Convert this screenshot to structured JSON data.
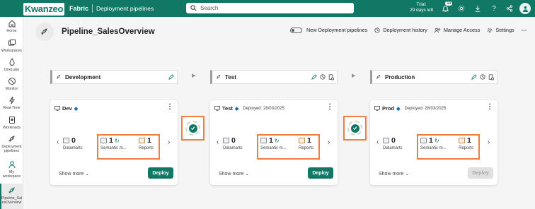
{
  "topbar": {
    "logo": "Kwanzeo",
    "app": "Fabric",
    "breadcrumb": "Deployment pipelines",
    "search_placeholder": "Search",
    "trial_line1": "Trial:",
    "trial_line2": "29 days left",
    "notif_count": "10"
  },
  "nav": [
    {
      "label": "Home",
      "icon": "home-icon"
    },
    {
      "label": "Workspaces",
      "icon": "workspaces-icon"
    },
    {
      "label": "OneLake",
      "icon": "onelake-icon"
    },
    {
      "label": "Monitor",
      "icon": "monitor-icon"
    },
    {
      "label": "Real-Time",
      "icon": "realtime-icon"
    },
    {
      "label": "Workloads",
      "icon": "workloads-icon"
    },
    {
      "label_line1": "Deployment",
      "label_line2": "pipelines",
      "icon": "deployment-pipelines-icon"
    },
    {
      "label_line1": "My",
      "label_line2": "workspace",
      "icon": "my-workspace-icon"
    },
    {
      "label_line1": "Pipeline_Sal",
      "label_line2": "esOverview",
      "icon": "pipeline-icon"
    }
  ],
  "page": {
    "title": "Pipeline_SalesOverview",
    "actions": {
      "new_pipelines": "New Deployment pipelines",
      "history": "Deployment history",
      "access": "Manage Access",
      "settings": "Settings",
      "more": "⋯"
    }
  },
  "stages": [
    {
      "name": "Development",
      "workspace": "Dev",
      "deployed": "",
      "datamarts": "0",
      "datamarts_label": "Datamarts",
      "semantic": "1",
      "semantic_label": "Semantic m...",
      "reports": "1",
      "reports_label": "Reports",
      "show_more": "Show more",
      "deploy": "Deploy",
      "deploy_enabled": true
    },
    {
      "name": "Test",
      "workspace": "Test",
      "deployed": "Deployed: 28/03/2025",
      "datamarts": "0",
      "datamarts_label": "Datamarts",
      "semantic": "1",
      "semantic_label": "Semantic m...",
      "reports": "1",
      "reports_label": "Reports",
      "show_more": "Show more",
      "deploy": "Deploy",
      "deploy_enabled": true
    },
    {
      "name": "Production",
      "workspace": "Prod",
      "deployed": "Deployed: 28/03/2025",
      "datamarts": "0",
      "datamarts_label": "Datamarts",
      "semantic": "1",
      "semantic_label": "Semantic m...",
      "reports": "1",
      "reports_label": "Reports",
      "show_more": "Show more",
      "deploy": "Deploy",
      "deploy_enabled": false
    }
  ],
  "colors": {
    "brand": "#117865",
    "highlight": "#f07e41"
  }
}
